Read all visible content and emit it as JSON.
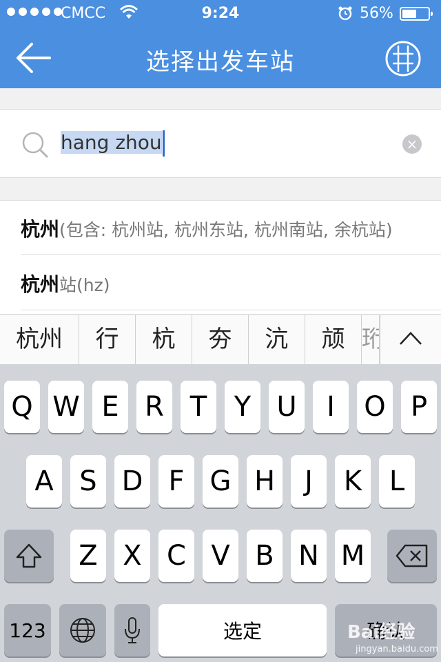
{
  "status_bar": {
    "carrier": "CMCC",
    "time": "9:24",
    "battery_percent": "56%",
    "battery_level": 0.56,
    "signal_icon": "signal-dots-icon",
    "wifi_icon": "wifi-icon",
    "alarm_icon": "alarm-clock-icon"
  },
  "nav": {
    "title": "选择出发车站",
    "back_icon": "arrow-left-icon",
    "map_icon": "map-grid-icon"
  },
  "search": {
    "query": "hang zhou",
    "search_icon": "search-icon",
    "clear_icon": "clear-x-icon"
  },
  "results": [
    {
      "main": "杭州",
      "sub": "(包含: 杭州站, 杭州东站, 杭州南站, 余杭站)"
    },
    {
      "main": "杭州",
      "sub": "站(hz)"
    }
  ],
  "candidates": {
    "items": [
      "杭州",
      "行",
      "杭",
      "夯",
      "沆",
      "颃"
    ],
    "partial": "珩",
    "expand_icon": "chevron-up-icon"
  },
  "keyboard": {
    "row1": [
      "Q",
      "W",
      "E",
      "R",
      "T",
      "Y",
      "U",
      "I",
      "O",
      "P"
    ],
    "row2": [
      "A",
      "S",
      "D",
      "F",
      "G",
      "H",
      "J",
      "K",
      "L"
    ],
    "row3": [
      "Z",
      "X",
      "C",
      "V",
      "B",
      "N",
      "M"
    ],
    "shift_icon": "shift-arrow-icon",
    "delete_icon": "backspace-icon",
    "numbers_label": "123",
    "globe_icon": "globe-icon",
    "mic_icon": "microphone-icon",
    "space_label": "选定",
    "return_label": "确认"
  },
  "watermark": {
    "brand": "Bai经验",
    "url": "jingyan.baidu.com"
  },
  "colors": {
    "header_blue": "#4a8fe0",
    "selection": "#c6d8f2",
    "caret": "#2d6bd4",
    "keyboard_bg": "#d1d4d9"
  }
}
